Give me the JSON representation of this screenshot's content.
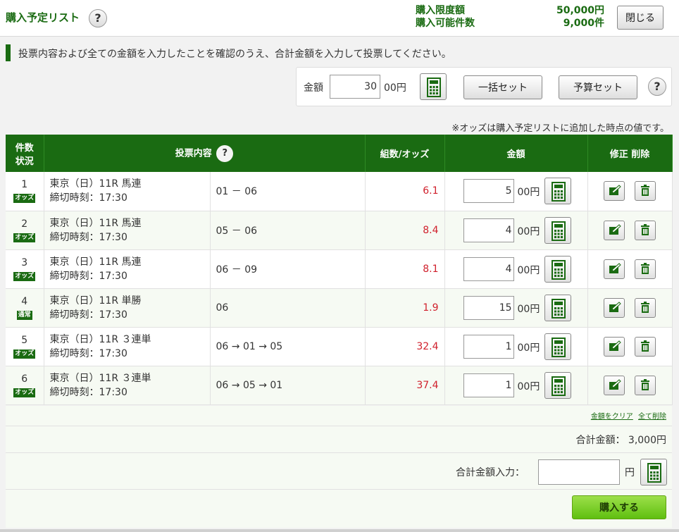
{
  "header": {
    "title": "購入予定リスト",
    "limit_label": "購入限度額",
    "limit_value": "50,000円",
    "available_label": "購入可能件数",
    "available_value": "9,000件",
    "close_label": "閉じる"
  },
  "notice": "投票内容および全ての金額を入力したことを確認のうえ、合計金額を入力して投票してください。",
  "amount_panel": {
    "label": "金額",
    "value": "30",
    "unit": "00円",
    "bulk_set": "一括セット",
    "budget_set": "予算セット"
  },
  "odds_note": "※オッズは購入予定リストに追加した時点の値です。",
  "table": {
    "headers": {
      "count_line1": "件数",
      "count_line2": "状況",
      "content": "投票内容",
      "odds": "組数/オッズ",
      "amount": "金額",
      "edit_delete": "修正 削除"
    },
    "rows": [
      {
        "no": "1",
        "badge": "オッズ",
        "race": "東京（日）11R 馬連",
        "deadline": "締切時刻：17:30",
        "combo": "01 － 06",
        "odds": "6.1",
        "amount": "5",
        "unit": "00円"
      },
      {
        "no": "2",
        "badge": "オッズ",
        "race": "東京（日）11R 馬連",
        "deadline": "締切時刻：17:30",
        "combo": "05 － 06",
        "odds": "8.4",
        "amount": "4",
        "unit": "00円"
      },
      {
        "no": "3",
        "badge": "オッズ",
        "race": "東京（日）11R 馬連",
        "deadline": "締切時刻：17:30",
        "combo": "06 － 09",
        "odds": "8.1",
        "amount": "4",
        "unit": "00円"
      },
      {
        "no": "4",
        "badge": "通常",
        "race": "東京（日）11R 単勝",
        "deadline": "締切時刻：17:30",
        "combo": "06",
        "odds": "1.9",
        "amount": "15",
        "unit": "00円"
      },
      {
        "no": "5",
        "badge": "オッズ",
        "race": "東京（日）11R ３連単",
        "deadline": "締切時刻：17:30",
        "combo": "06 → 01 → 05",
        "odds": "32.4",
        "amount": "1",
        "unit": "00円"
      },
      {
        "no": "6",
        "badge": "オッズ",
        "race": "東京（日）11R ３連単",
        "deadline": "締切時刻：17:30",
        "combo": "06 → 05 → 01",
        "odds": "37.4",
        "amount": "1",
        "unit": "00円"
      }
    ]
  },
  "footer": {
    "clear_amounts": "金額をクリア",
    "delete_all": "全て削除",
    "total_label": "合計金額：",
    "total_value": "3,000円",
    "total_input_label": "合計金額入力：",
    "total_input_value": "",
    "total_input_unit": "円",
    "buy_label": "購入する"
  },
  "colors": {
    "brand_green": "#1a6b12",
    "odds_red": "#d0202c",
    "buy_button": "#6cc51a"
  }
}
